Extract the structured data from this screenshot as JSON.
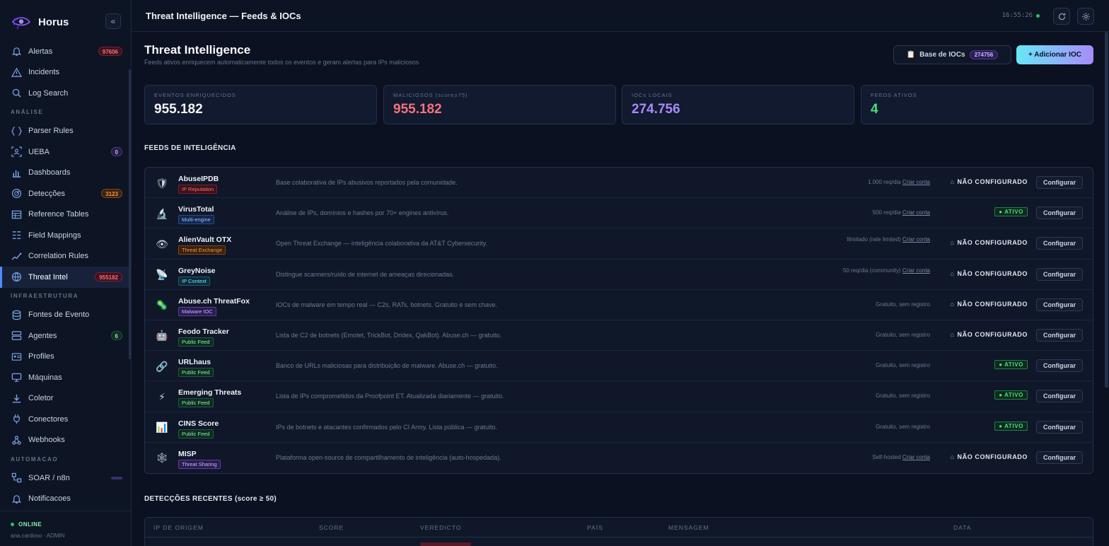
{
  "app": {
    "name": "Horus",
    "collapse_glyph": "«"
  },
  "sidebar": {
    "items": [
      {
        "label": "Alertas",
        "icon": "bell-icon",
        "badge": "97606",
        "badge_color": "red"
      },
      {
        "label": "Incidents",
        "icon": "warning-icon"
      },
      {
        "label": "Log Search",
        "icon": "search-icon"
      },
      {
        "section": "ANÁLISE"
      },
      {
        "label": "Parser Rules",
        "icon": "brackets-icon"
      },
      {
        "label": "UEBA",
        "icon": "user-scan-icon",
        "badge": "0",
        "badge_color": "purple"
      },
      {
        "label": "Dashboards",
        "icon": "bar-chart-icon"
      },
      {
        "label": "Detecções",
        "icon": "radar-icon",
        "badge": "3123",
        "badge_color": "orange"
      },
      {
        "label": "Reference Tables",
        "icon": "table-icon"
      },
      {
        "label": "Field Mappings",
        "icon": "mapping-icon"
      },
      {
        "label": "Correlation Rules",
        "icon": "trend-icon"
      },
      {
        "label": "Threat Intel",
        "icon": "globe-icon",
        "badge": "955182",
        "badge_color": "red",
        "active": true
      },
      {
        "section": "INFRAESTRUTURA"
      },
      {
        "label": "Fontes de Evento",
        "icon": "database-icon"
      },
      {
        "label": "Agentes",
        "icon": "server-icon",
        "badge": "6",
        "badge_color": "green"
      },
      {
        "label": "Profiles",
        "icon": "id-card-icon"
      },
      {
        "label": "Máquinas",
        "icon": "monitor-icon"
      },
      {
        "label": "Coletor",
        "icon": "download-icon"
      },
      {
        "label": "Conectores",
        "icon": "plug-icon"
      },
      {
        "label": "Webhooks",
        "icon": "webhook-icon"
      },
      {
        "section": "AUTOMACAO"
      },
      {
        "label": "SOAR / n8n",
        "icon": "workflow-icon",
        "badge": "",
        "badge_color": "empty"
      },
      {
        "label": "Notificacoes",
        "icon": "bell-icon"
      }
    ],
    "status": "ONLINE",
    "user": "ana.cardoso · ADMIN"
  },
  "topbar": {
    "title": "Threat Intelligence — Feeds & IOCs",
    "clock": "16:55:26"
  },
  "page": {
    "title": "Threat Intelligence",
    "subtitle": "Feeds ativos enriquecem automaticamente todos os eventos e geram alertas para IPs maliciosos",
    "ioc_base_label": "Base de IOCs",
    "ioc_base_count": "274756",
    "add_ioc_label": "+ Adicionar IOC"
  },
  "kpis": [
    {
      "label": "EVENTOS ENRIQUECIDOS",
      "value": "955.182",
      "color": "#f1f5f9"
    },
    {
      "label": "MALICIOSOS (score≥75)",
      "value": "955.182",
      "color": "#f8717f"
    },
    {
      "label": "IOCs LOCAIS",
      "value": "274.756",
      "color": "#a78bfa"
    },
    {
      "label": "FEEDS ATIVOS",
      "value": "4",
      "color": "#4ade80"
    }
  ],
  "feeds_title": "FEEDS DE INTELIGÊNCIA",
  "feeds": [
    {
      "name": "AbuseIPDB",
      "tag": "IP Reputation",
      "tag_color": "red",
      "icon": "shield-icon",
      "glyph": "🛡",
      "desc": "Base colaborativa de IPs abusivos reportados pela comunidade.",
      "limit": "1.000 req/dia",
      "link": "Criar conta",
      "status": "NÃO CONFIGURADO",
      "active": false
    },
    {
      "name": "VirusTotal",
      "tag": "Multi-engine",
      "tag_color": "blue",
      "icon": "microscope-icon",
      "glyph": "🔬",
      "desc": "Análise de IPs, domínios e hashes por 70+ engines antivírus.",
      "limit": "500 req/dia",
      "link": "Criar conta",
      "status": "● ATIVO",
      "active": true
    },
    {
      "name": "AlienVault OTX",
      "tag": "Threat Exchange",
      "tag_color": "orange",
      "icon": "eye-icon",
      "glyph": "👁",
      "desc": "Open Threat Exchange — inteligência colaborativa da AT&T Cybersecurity.",
      "limit": "Ilimitado (rate limited)",
      "link": "Criar conta",
      "status": "NÃO CONFIGURADO",
      "active": false
    },
    {
      "name": "GreyNoise",
      "tag": "IP Context",
      "tag_color": "cyan",
      "icon": "satellite-icon",
      "glyph": "📡",
      "desc": "Distingue scanners/ruído de internet de ameaças direcionadas.",
      "limit": "50 req/dia (community)",
      "link": "Criar conta",
      "status": "NÃO CONFIGURADO",
      "active": false
    },
    {
      "name": "Abuse.ch ThreatFox",
      "tag": "Malware IOC",
      "tag_color": "purple",
      "icon": "virus-icon",
      "glyph": "🦠",
      "desc": "IOCs de malware em tempo real — C2s, RATs, botnets. Gratuito e sem chave.",
      "limit": "Gratuito, sem registro",
      "link": "",
      "status": "NÃO CONFIGURADO",
      "active": false
    },
    {
      "name": "Feodo Tracker",
      "tag": "Public Feed",
      "tag_color": "green",
      "icon": "robot-icon",
      "glyph": "🤖",
      "desc": "Lista de C2 de botnets (Emotet, TrickBot, Dridex, QakBot). Abuse.ch — gratuito.",
      "limit": "Gratuito, sem registro",
      "link": "",
      "status": "NÃO CONFIGURADO",
      "active": false
    },
    {
      "name": "URLhaus",
      "tag": "Public Feed",
      "tag_color": "green",
      "icon": "link-icon",
      "glyph": "🔗",
      "desc": "Banco de URLs maliciosas para distribuição de malware. Abuse.ch — gratuito.",
      "limit": "Gratuito, sem registro",
      "link": "",
      "status": "● ATIVO",
      "active": true
    },
    {
      "name": "Emerging Threats",
      "tag": "Public Feed",
      "tag_color": "green",
      "icon": "bolt-icon",
      "glyph": "⚡",
      "desc": "Lista de IPs comprometidos da Proofpoint ET. Atualizada diariamente — gratuito.",
      "limit": "Gratuito, sem registro",
      "link": "",
      "status": "● ATIVO",
      "active": true
    },
    {
      "name": "CINS Score",
      "tag": "Public Feed",
      "tag_color": "green",
      "icon": "chart-icon",
      "glyph": "📊",
      "desc": "IPs de botnets e atacantes confirmados pelo CI Army. Lista pública — gratuito.",
      "limit": "Gratuito, sem registro",
      "link": "",
      "status": "● ATIVO",
      "active": true
    },
    {
      "name": "MISP",
      "tag": "Threat Sharing",
      "tag_color": "purple",
      "icon": "network-icon",
      "glyph": "🕸",
      "desc": "Plataforma open-source de compartilhamento de inteligência (auto-hospedada).",
      "limit": "Self-hosted",
      "link": "Criar conta",
      "status": "NÃO CONFIGURADO",
      "active": false
    }
  ],
  "configure_label": "Configurar",
  "not_configured_prefix": "⌂",
  "detections_title": "DETECÇÕES RECENTES (score ≥ 50)",
  "detections_columns": [
    "IP DE ORIGEM",
    "SCORE",
    "VEREDICTO",
    "PAÍS",
    "MENSAGEM",
    "DATA"
  ]
}
